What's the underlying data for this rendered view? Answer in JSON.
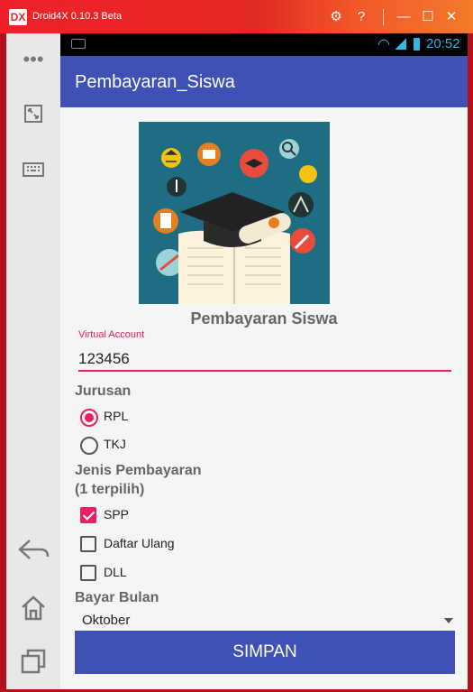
{
  "emulator": {
    "title": "Droid4X 0.10.3 Beta",
    "logo": "DX",
    "buttons": [
      "settings-icon",
      "help-icon",
      "minimize-icon",
      "maximize-icon",
      "close-icon"
    ],
    "sidebar": [
      "more-icon",
      "fullscreen-icon",
      "keyboard-icon",
      "back-icon",
      "home-icon",
      "recents-icon"
    ]
  },
  "status_bar": {
    "time": "20:52"
  },
  "app": {
    "title": "Pembayaran_Siswa"
  },
  "form": {
    "heading": "Pembayaran Siswa",
    "virtual_account": {
      "label": "Virtual Account",
      "value": "123456"
    },
    "jurusan": {
      "label": "Jurusan",
      "options": [
        {
          "label": "RPL",
          "selected": true
        },
        {
          "label": "TKJ",
          "selected": false
        }
      ]
    },
    "jenis_pembayaran": {
      "label": "Jenis Pembayaran",
      "sublabel": "(1 terpilih)",
      "options": [
        {
          "label": "SPP",
          "checked": true
        },
        {
          "label": "Daftar Ulang",
          "checked": false
        },
        {
          "label": "DLL",
          "checked": false
        }
      ]
    },
    "bayar_bulan": {
      "label": "Bayar Bulan",
      "selected": "Oktober"
    },
    "submit_label": "SIMPAN"
  },
  "colors": {
    "primary": "#3f51b5",
    "accent": "#e91e63",
    "titlebar": "#e42a24"
  }
}
